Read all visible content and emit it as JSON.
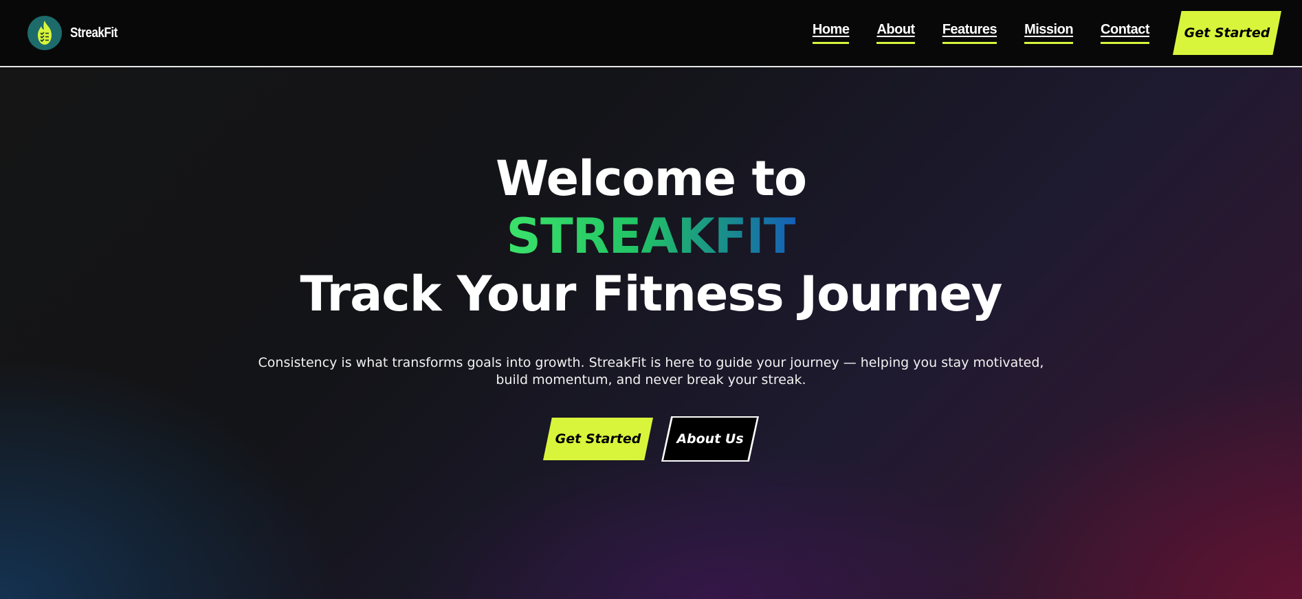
{
  "nav": {
    "brand": "StreakFit",
    "logo_icon": "flame-checklist-icon",
    "links": [
      "Home",
      "About",
      "Features",
      "Mission",
      "Contact"
    ],
    "cta": "Get Started"
  },
  "hero": {
    "line1": "Welcome to",
    "brand": "STREAKFIT",
    "line3": "Track Your Fitness Journey",
    "description": "Consistency is what transforms goals into growth. StreakFit is here to guide your journey — helping you stay motivated, build momentum, and never break your streak.",
    "primary_button": "Get Started",
    "secondary_button": "About Us"
  },
  "colors": {
    "accent": "#d8f53c",
    "nav_bg": "#080808",
    "logo_bg": "#1e6b6b",
    "brand_gradient_start": "#3be26a",
    "brand_gradient_end": "#1560b8"
  }
}
